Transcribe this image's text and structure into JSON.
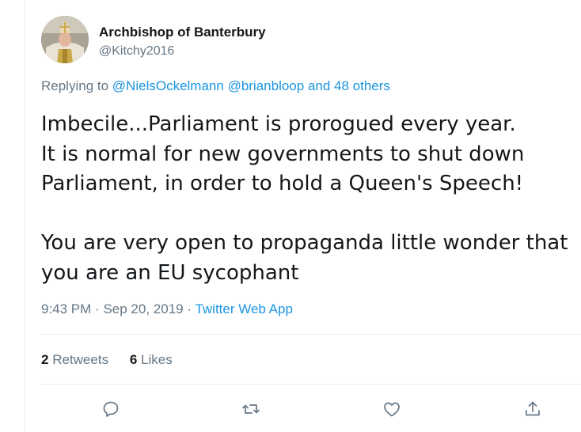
{
  "author": {
    "display_name": "Archbishop of Banterbury",
    "handle": "@Kitchy2016"
  },
  "reply": {
    "prefix": "Replying to",
    "mentions": [
      "@NielsOckelmann",
      "@brianbloop"
    ],
    "others": "and 48 others"
  },
  "tweet": {
    "lines": [
      "Imbecile...Parliament is prorogued every year.",
      "It is normal for new governments to shut down",
      "Parliament, in order to hold a Queen's Speech!",
      "",
      "You are very open to propaganda little wonder that",
      "you are an EU sycophant"
    ]
  },
  "meta": {
    "time": "9:43 PM",
    "separator": "·",
    "date": "Sep 20, 2019",
    "source": "Twitter Web App"
  },
  "stats": {
    "retweets_count": "2",
    "retweets_label": "Retweets",
    "likes_count": "6",
    "likes_label": "Likes"
  },
  "actions": [
    {
      "name": "reply-icon"
    },
    {
      "name": "retweet-icon"
    },
    {
      "name": "like-icon"
    },
    {
      "name": "share-icon"
    }
  ],
  "colors": {
    "text": "#14171a",
    "secondary": "#657786",
    "link": "#1b95e0",
    "divider": "#e6ecf0"
  }
}
